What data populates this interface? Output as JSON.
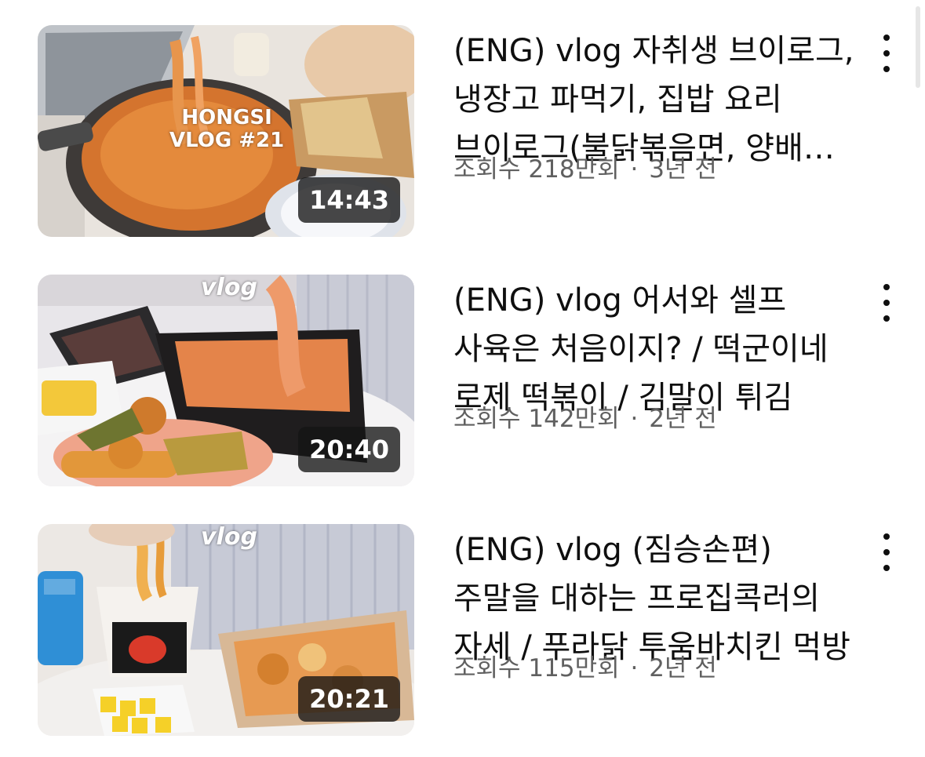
{
  "videos": [
    {
      "title": "(ENG) vlog 자취생 브이로그, 냉장고 파먹기, 집밥 요리 브이로그(불닭볶음면, 양배추 전, 만두",
      "views": "조회수 218만회",
      "age": "3년 전",
      "duration": "14:43",
      "thumb_caption": "HONGSI\nVLOG #21"
    },
    {
      "title": "(ENG) vlog 어서와 셀프 사육은 처음이지? / 떡군이네 로제 떡볶이 / 김말이 튀김",
      "views": "조회수 142만회",
      "age": "2년 전",
      "duration": "20:40",
      "thumb_caption": "vlog"
    },
    {
      "title": "(ENG) vlog (짐승손편) 주말을 대하는 프로집콕러의 자세 / 푸라닭 투움바치킨 먹방",
      "views": "조회수 115만회",
      "age": "2년 전",
      "duration": "20:21",
      "thumb_caption": "vlog"
    }
  ],
  "separator": "·",
  "icons": {
    "more": "more-vert-icon"
  }
}
